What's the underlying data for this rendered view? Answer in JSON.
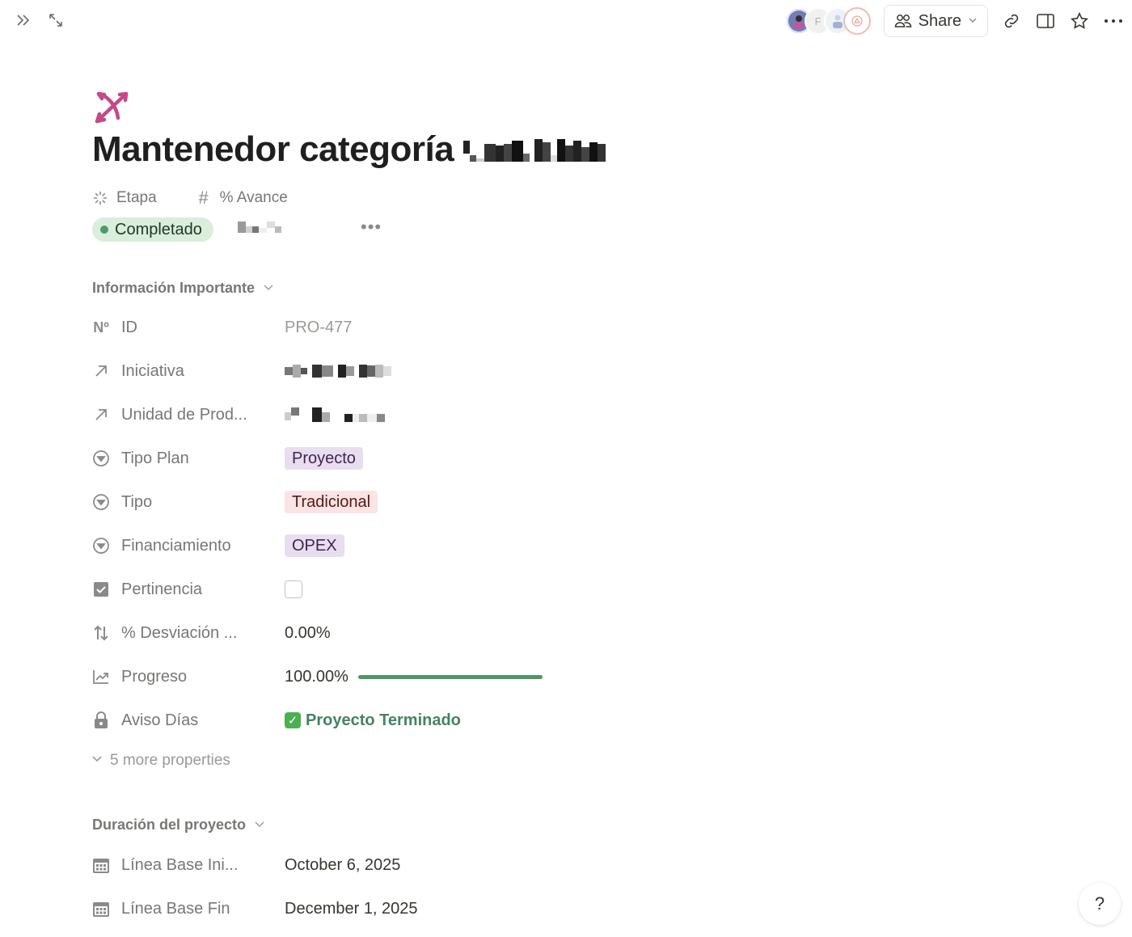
{
  "topbar": {
    "share_label": "Share",
    "avatar_initial": "F"
  },
  "page": {
    "title": "Mantenedor categoría"
  },
  "top_properties": {
    "etapa_label": "Etapa",
    "etapa_value": "Completado",
    "avance_label": "% Avance"
  },
  "sections": {
    "info_title": "Información Importante",
    "duration_title": "Duración del proyecto",
    "more_properties": "5 more properties"
  },
  "properties": {
    "id_label": "ID",
    "id_value": "PRO-477",
    "iniciativa_label": "Iniciativa",
    "unidad_label": "Unidad de Prod...",
    "tipo_plan_label": "Tipo Plan",
    "tipo_plan_value": "Proyecto",
    "tipo_label": "Tipo",
    "tipo_value": "Tradicional",
    "financiamiento_label": "Financiamiento",
    "financiamiento_value": "OPEX",
    "pertinencia_label": "Pertinencia",
    "desviacion_label": "% Desviación ...",
    "desviacion_value": "0.00%",
    "progreso_label": "Progreso",
    "progreso_value": "100.00%",
    "progreso_fraction": 1.0,
    "aviso_label": "Aviso Días",
    "aviso_value": "Proyecto Terminado"
  },
  "duration": {
    "inicio_label": "Línea Base Ini...",
    "inicio_value": "October 6, 2025",
    "fin_label": "Línea Base Fin",
    "fin_value": "December 1, 2025"
  },
  "help_label": "?",
  "colors": {
    "stage_bg": "#dbeddb",
    "stage_dot": "#4c9b6a",
    "tag_purple": "#e8deee",
    "tag_red": "#fbe4e4",
    "progress": "#4f9768",
    "done_text": "#448361",
    "page_icon": "#c44a86"
  }
}
